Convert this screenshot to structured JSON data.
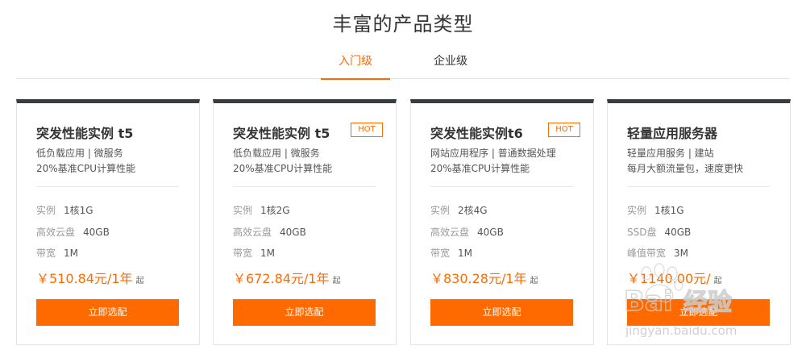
{
  "section": {
    "title": "丰富的产品类型"
  },
  "tabs": [
    {
      "label": "入门级",
      "active": true
    },
    {
      "label": "企业级",
      "active": false
    }
  ],
  "cards": [
    {
      "title": "突发性能实例 t5",
      "hot": false,
      "desc1": "低负载应用 | 微服务",
      "desc2": "20%基准CPU计算性能",
      "specs": [
        {
          "key": "实例",
          "value": "1核1G"
        },
        {
          "key": "高效云盘",
          "value": "40GB"
        },
        {
          "key": "带宽",
          "value": "1M"
        }
      ],
      "price": "￥510.84元/1年",
      "price_suffix": "起",
      "button": "立即选配"
    },
    {
      "title": "突发性能实例 t5",
      "hot": true,
      "hot_label": "HOT",
      "desc1": "低负载应用 | 微服务",
      "desc2": "20%基准CPU计算性能",
      "specs": [
        {
          "key": "实例",
          "value": "1核2G"
        },
        {
          "key": "高效云盘",
          "value": "40GB"
        },
        {
          "key": "带宽",
          "value": "1M"
        }
      ],
      "price": "￥672.84元/1年",
      "price_suffix": "起",
      "button": "立即选配"
    },
    {
      "title": "突发性能实例t6",
      "hot": true,
      "hot_label": "HOT",
      "desc1": "网站应用程序 | 普通数据处理",
      "desc2": "20%基准CPU计算性能",
      "specs": [
        {
          "key": "实例",
          "value": "2核4G"
        },
        {
          "key": "高效云盘",
          "value": "40GB"
        },
        {
          "key": "带宽",
          "value": "1M"
        }
      ],
      "price": "￥830.28元/1年",
      "price_suffix": "起",
      "button": "立即选配"
    },
    {
      "title": "轻量应用服务器",
      "hot": false,
      "desc1": "轻量应用服务 | 建站",
      "desc2": "每月大额流量包，速度更快",
      "specs": [
        {
          "key": "实例",
          "value": "1核1G"
        },
        {
          "key": "SSD盘",
          "value": "40GB"
        },
        {
          "key": "峰值带宽",
          "value": "3M"
        }
      ],
      "price": "￥1140.00元/",
      "price_suffix": "起",
      "button": "立即选配"
    }
  ],
  "watermark": {
    "brand": "Bai经验",
    "url": "jingyan.baidu.com"
  },
  "colors": {
    "accent": "#ff6a00",
    "card_top_border": "#373d41"
  }
}
